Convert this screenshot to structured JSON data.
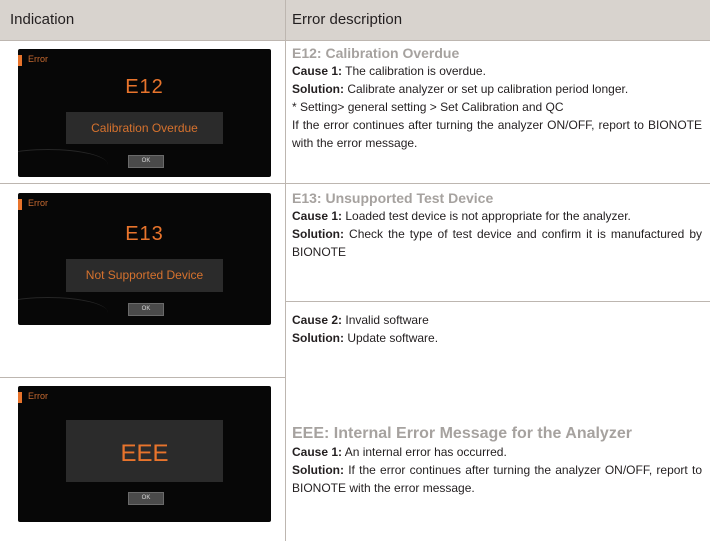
{
  "header": {
    "indication": "Indication",
    "description": "Error description"
  },
  "colors": {
    "header_bg": "#d8d3ce",
    "accent": "#e8742c",
    "title": "#a6a29f"
  },
  "rows": [
    {
      "screen": {
        "label": "Error",
        "code": "E12",
        "message": "Calibration Overdue",
        "ok": "OK"
      },
      "title": "E12: Calibration Overdue",
      "cause1_label": "Cause 1:",
      "cause1_text": "The calibration is overdue.",
      "solution_label": "Solution:",
      "solution_text": "Calibrate analyzer or set up calibration period longer.",
      "note": "* Setting> general setting > Set Calibration and QC",
      "extra": "If the error continues after turning the analyzer ON/OFF, report to BIONOTE with the error message."
    },
    {
      "screen": {
        "label": "Error",
        "code": "E13",
        "message": "Not Supported Device",
        "ok": "OK"
      },
      "title": "E13: Unsupported Test Device",
      "cause1_label": "Cause 1:",
      "cause1_text": "Loaded test device is not appropriate for the analyzer.",
      "solution1_label": "Solution:",
      "solution1_text": "Check the type of test device and confirm it is manufactured by BIONOTE",
      "cause2_label": "Cause 2:",
      "cause2_text": "Invalid software",
      "solution2_label": "Solution:",
      "solution2_text": "Update software."
    },
    {
      "screen": {
        "label": "Error",
        "code": "EEE",
        "ok": "OK"
      },
      "title": "EEE: Internal Error Message for the Analyzer",
      "cause1_label": "Cause 1:",
      "cause1_text": "An internal error has occurred.",
      "solution_label": "Solution:",
      "solution_text": "If the error continues after turning the analyzer ON/OFF, report to BIONOTE with the error message."
    }
  ]
}
